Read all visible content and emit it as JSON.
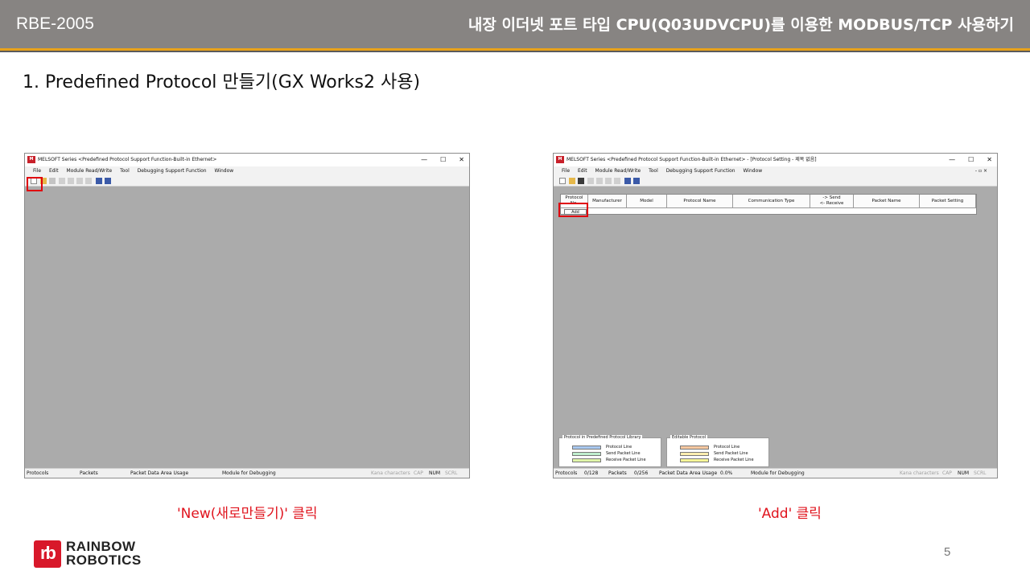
{
  "header": {
    "doc_code": "RBE-2005",
    "title": "내장 이더넷 포트 타입 CPU(Q03UDVCPU)를 이용한 MODBUS/TCP 사용하기"
  },
  "section_title": "1. Predefined Protocol 만들기(GX Works2 사용)",
  "left_window": {
    "title": "MELSOFT Series <Predefined Protocol Support Function-Built-in Ethernet>",
    "app_icon_text": "M",
    "controls": [
      "—",
      "☐",
      "✕"
    ],
    "menu": [
      "File",
      "Edit",
      "Module Read/Write",
      "Tool",
      "Debugging Support Function",
      "Window"
    ],
    "status": {
      "protocols": "Protocols",
      "packets": "Packets",
      "packet_data_area": "Packet Data Area Usage",
      "module_debug": "Module for Debugging",
      "kana": "Kana characters",
      "cap": "CAP",
      "num": "NUM",
      "scrl": "SCRL"
    }
  },
  "right_window": {
    "title": "MELSOFT Series <Predefined Protocol Support Function-Built-in Ethernet> - [Protocol Setting - 제목 없음]",
    "app_icon_text": "M",
    "controls": [
      "—",
      "☐",
      "✕"
    ],
    "inner_controls": "- ▫ ×",
    "menu": [
      "File",
      "Edit",
      "Module Read/Write",
      "Tool",
      "Debugging Support Function",
      "Window"
    ],
    "table_headers": {
      "protocol": "Protocol",
      "protocol_no": "No.",
      "manufacturer": "Manufacturer",
      "model": "Model",
      "protocol_name": "Protocol Name",
      "comm_type": "Communication Type",
      "send": "-> Send",
      "receive": "<- Receive",
      "packet_name": "Packet Name",
      "packet_setting": "Packet Setting"
    },
    "add_label": "Add",
    "legend_library": {
      "title": "Protocol in Predefined Protocol Library",
      "rows": [
        "Protocol Line",
        "Send Packet Line",
        "Receive Packet Line"
      ],
      "colors": [
        "#a8c8f0",
        "#bfeecd",
        "#e0f6a8"
      ]
    },
    "legend_editable": {
      "title": "Editable Protocol",
      "rows": [
        "Protocol Line",
        "Send Packet Line",
        "Receive Packet Line"
      ],
      "colors": [
        "#f8c8a0",
        "#ffeeb0",
        "#f8f898"
      ]
    },
    "status": {
      "protocols": "Protocols",
      "protocols_val": "0/128",
      "packets": "Packets",
      "packets_val": "0/256",
      "packet_data_area": "Packet Data Area Usage",
      "packet_data_val": "0.0%",
      "module_debug": "Module for Debugging",
      "kana": "Kana characters",
      "cap": "CAP",
      "num": "NUM",
      "scrl": "SCRL"
    }
  },
  "captions": {
    "left": "'New(새로만들기)' 클릭",
    "right": "'Add' 클릭"
  },
  "logo": {
    "mark": "rb",
    "line1": "RAINBOW",
    "line2": "ROBOTICS"
  },
  "page_number": "5",
  "colors": {
    "header_bg": "#878482",
    "header_accent": "#e8a21a",
    "highlight": "#e0000e",
    "brand_red": "#d8182a"
  }
}
